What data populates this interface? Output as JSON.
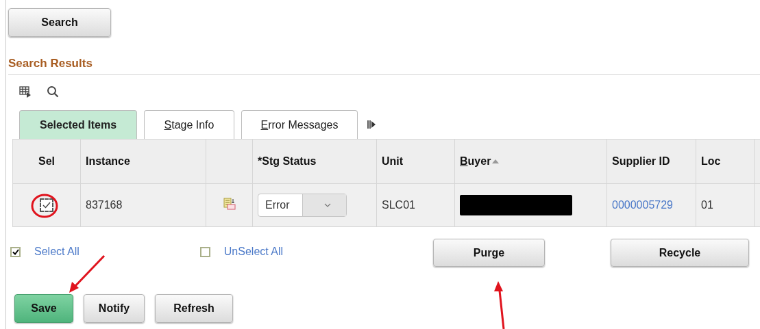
{
  "search_button": "Search",
  "section_title": "Search Results",
  "tabs": [
    {
      "label": "Selected Items",
      "selected": true,
      "mnemonic": false
    },
    {
      "label": "Stage Info",
      "selected": false,
      "mnemonic": true
    },
    {
      "label": "Error Messages",
      "selected": false,
      "mnemonic": true
    }
  ],
  "table": {
    "columns": [
      {
        "label": "Sel",
        "mnemonic": false,
        "sorted": false
      },
      {
        "label": "Instance",
        "mnemonic": false,
        "sorted": false
      },
      {
        "sorted": false
      },
      {
        "label": "*Stg Status",
        "mnemonic": false,
        "sorted": false
      },
      {
        "label": "Unit",
        "mnemonic": false,
        "sorted": false
      },
      {
        "label": "Buyer",
        "mnemonic": true,
        "sorted": true
      },
      {
        "label": "Supplier ID",
        "mnemonic": false,
        "sorted": false
      },
      {
        "label": "Loc",
        "mnemonic": false,
        "sorted": false
      }
    ],
    "rows": [
      {
        "checked": true,
        "instance": "837168",
        "status": "Error",
        "unit": "SLC01",
        "buyer_redacted": true,
        "supplier_id": "0000005729",
        "loc": "01"
      }
    ]
  },
  "select_links": [
    {
      "label": "Select All",
      "checked": true
    },
    {
      "label": "UnSelect All",
      "checked": false
    }
  ],
  "middle_buttons": [
    {
      "label": "Purge"
    },
    {
      "label": "Recycle"
    }
  ],
  "bottom_buttons": [
    {
      "label": "Save",
      "primary": true
    },
    {
      "label": "Notify",
      "primary": false
    },
    {
      "label": "Refresh",
      "primary": false
    }
  ]
}
